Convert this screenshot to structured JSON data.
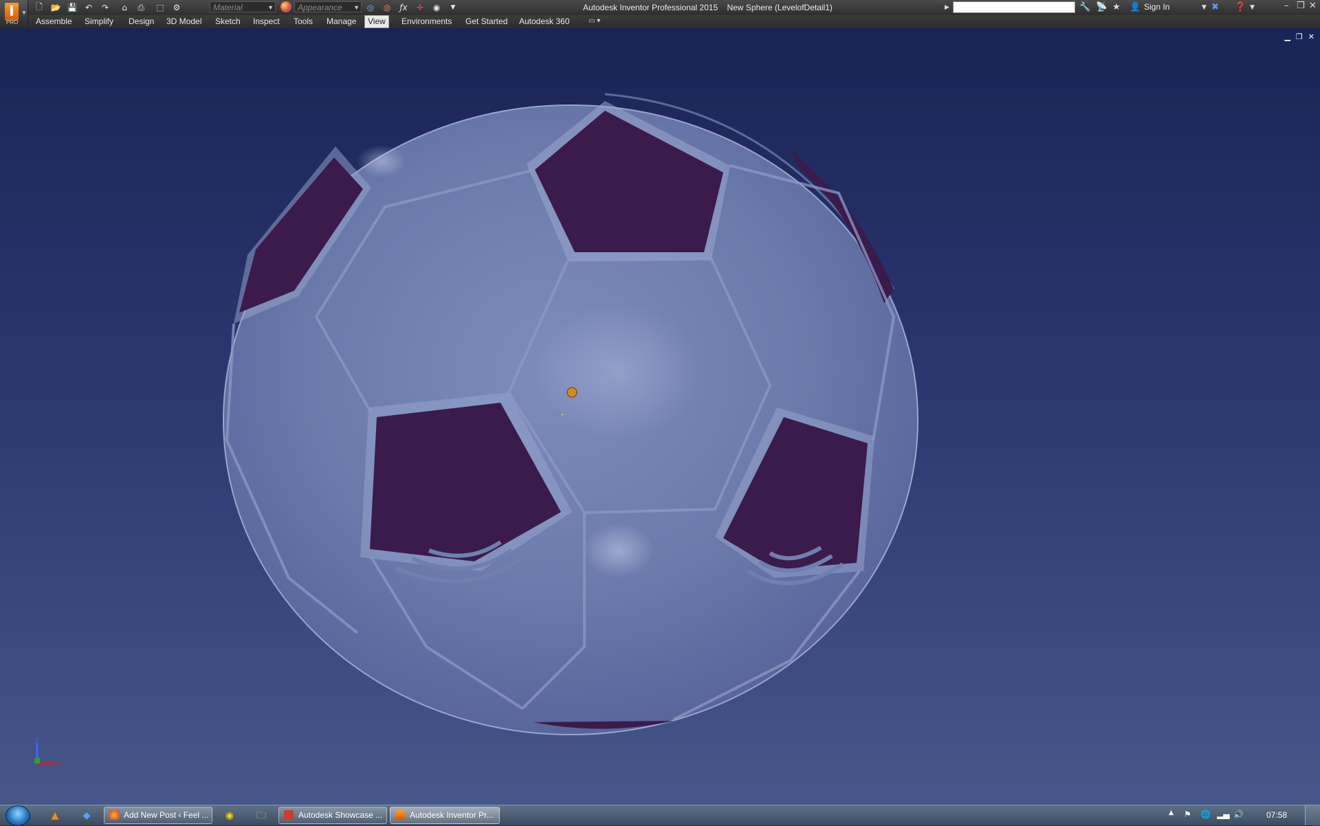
{
  "app": {
    "badge": "PRO",
    "title": "Autodesk Inventor Professional 2015",
    "document": "New Sphere (LevelofDetail1)"
  },
  "quick_access": {
    "material_placeholder": "Material",
    "appearance_placeholder": "Appearance",
    "icons": [
      "new-icon",
      "open-icon",
      "save-icon",
      "undo-icon",
      "redo-icon",
      "home-icon",
      "print-icon",
      "select-icon",
      "update-icon",
      "material-icon",
      "appearance-icon",
      "zoom-icon",
      "parameters-icon",
      "measure-icon",
      "project-icon",
      "customize-icon"
    ]
  },
  "header_right": {
    "sign_in": "Sign In",
    "icons": [
      "key-icon",
      "satellite-icon",
      "star-icon",
      "user-icon",
      "exchange-icon",
      "help-icon"
    ]
  },
  "tabs": [
    {
      "label": "Assemble"
    },
    {
      "label": "Simplify"
    },
    {
      "label": "Design"
    },
    {
      "label": "3D Model"
    },
    {
      "label": "Sketch"
    },
    {
      "label": "Inspect"
    },
    {
      "label": "Tools"
    },
    {
      "label": "Manage"
    },
    {
      "label": "View",
      "active": true
    },
    {
      "label": "Environments"
    },
    {
      "label": "Get Started"
    },
    {
      "label": "Autodesk 360"
    }
  ],
  "viewport": {
    "model": "soccer-ball sphere assembly",
    "colors": {
      "background_top": "#1a2355",
      "background_bottom": "#46578a",
      "shell": "#6f7fb0",
      "panel": "#3d1d4f",
      "seam": "#9aa6cf"
    },
    "triad_labels": {
      "z": "Z",
      "x": "X"
    }
  },
  "taskbar": {
    "pinned": [
      "vlc-icon",
      "dropbox-icon",
      "chrome-icon",
      "explorer-icon"
    ],
    "tasks": [
      {
        "label": "Add New Post ‹ Feel ...",
        "icon": "firefox-icon"
      },
      {
        "label": "Autodesk Showcase ...",
        "icon": "showcase-icon"
      },
      {
        "label": "Autodesk Inventor Pr...",
        "icon": "inventor-icon",
        "active": true
      }
    ],
    "clock": "07:58"
  }
}
